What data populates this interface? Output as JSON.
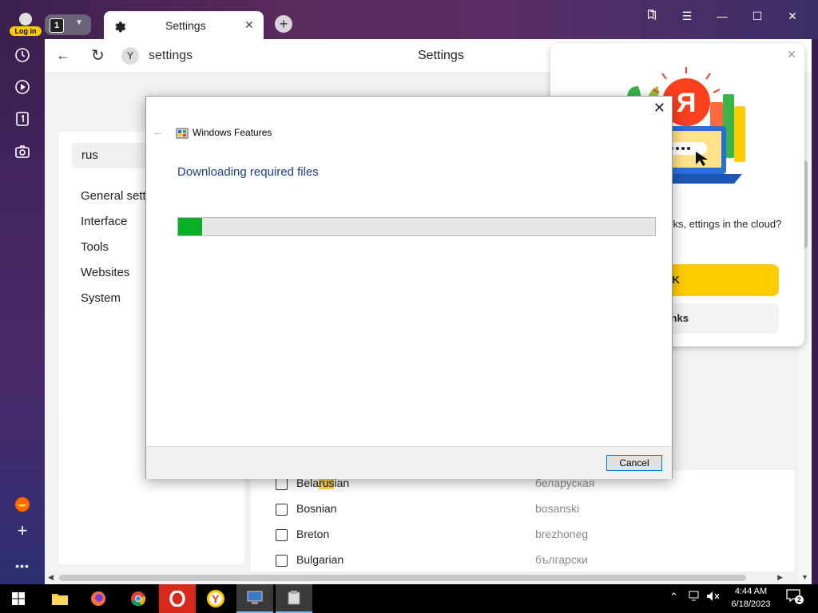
{
  "browser": {
    "login_label": "Log in",
    "tab_count": "1",
    "active_tab_title": "Settings",
    "address_url": "settings",
    "page_title": "Settings"
  },
  "settings": {
    "search_value": "rus",
    "nav": [
      "General setti",
      "Interface",
      "Tools",
      "Websites",
      "System"
    ],
    "languages": [
      {
        "name_pre": "Bela",
        "name_match": "rus",
        "name_post": "ian",
        "native": "беларуская"
      },
      {
        "name_pre": "Bosnian",
        "name_match": "",
        "name_post": "",
        "native": "bosanski"
      },
      {
        "name_pre": "Breton",
        "name_match": "",
        "name_post": "",
        "native": "brezhoneg"
      },
      {
        "name_pre": "Bulgarian",
        "name_match": "",
        "name_post": "",
        "native": "български"
      }
    ]
  },
  "sync_popup": {
    "question": "o store your bookmarks, ettings in the cloud?",
    "ok_label": "OK",
    "no_label": "thanks"
  },
  "dialog": {
    "app_title": "Windows Features",
    "heading": "Downloading required files",
    "progress_percent": 5,
    "cancel_label": "Cancel"
  },
  "taskbar": {
    "time": "4:44 AM",
    "date": "6/18/2023",
    "notification_count": "2"
  },
  "colors": {
    "progress_fill": "#06b025",
    "accent_yellow": "#ffcc00",
    "dialog_heading": "#1e3c8c"
  }
}
